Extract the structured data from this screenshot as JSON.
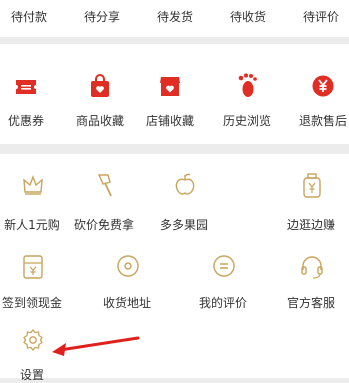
{
  "orders": {
    "tabs": [
      "待付款",
      "待分享",
      "待发货",
      "待收货",
      "待评价"
    ]
  },
  "assets": {
    "items": [
      {
        "label": "优惠券",
        "icon": "coupon-icon"
      },
      {
        "label": "商品收藏",
        "icon": "bag-heart-icon"
      },
      {
        "label": "店铺收藏",
        "icon": "store-heart-icon"
      },
      {
        "label": "历史浏览",
        "icon": "footprint-icon"
      },
      {
        "label": "退款售后",
        "icon": "yen-refund-icon"
      }
    ]
  },
  "services": {
    "items": [
      {
        "label": "新人1元购",
        "icon": "crown-icon"
      },
      {
        "label": "砍价免费拿",
        "icon": "axe-icon"
      },
      {
        "label": "多多果园",
        "icon": "fruit-icon"
      },
      {
        "label": "边逛边赚",
        "icon": "money-jar-icon"
      },
      {
        "label": "签到领现金",
        "icon": "cash-envelope-icon"
      },
      {
        "label": "收货地址",
        "icon": "location-icon"
      },
      {
        "label": "我的评价",
        "icon": "comment-icon"
      },
      {
        "label": "官方客服",
        "icon": "headset-icon"
      },
      {
        "label": "设置",
        "icon": "gear-icon"
      }
    ]
  },
  "colors": {
    "brand_red": "#e02e24",
    "icon_outline": "#c8a45c",
    "annotation_arrow": "#e0201c"
  }
}
